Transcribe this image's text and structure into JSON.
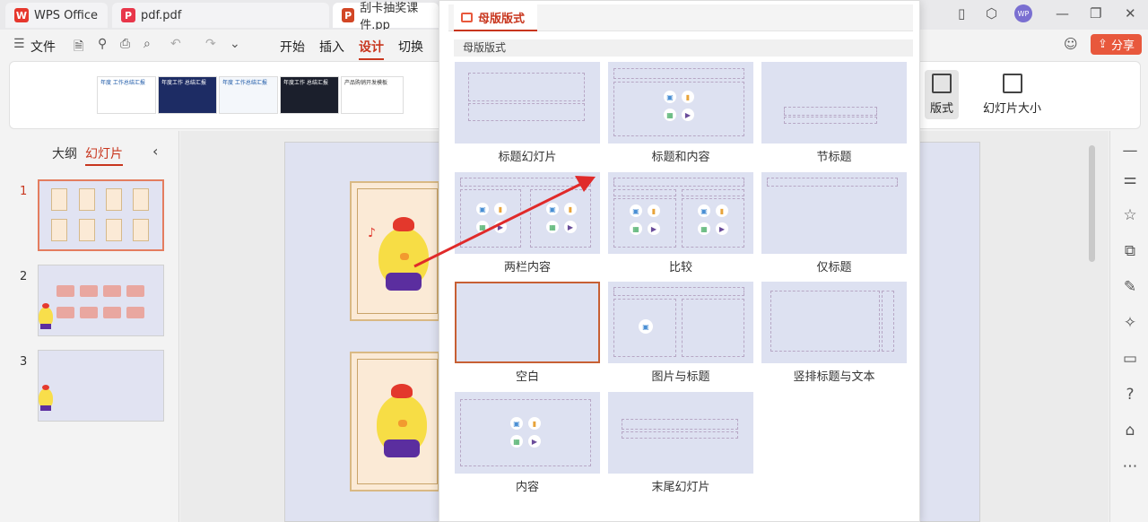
{
  "tabs": [
    {
      "label": "WPS Office",
      "icon": "wps-logo-icon",
      "color": "#e6372d"
    },
    {
      "label": "pdf.pdf",
      "icon": "pdf-file-icon",
      "color": "#e8364a"
    },
    {
      "label": "刮卡抽奖课件.pp",
      "icon": "ppt-file-icon",
      "color": "#d24625"
    }
  ],
  "user_avatar": "WP",
  "menu": {
    "file": "文件",
    "items": [
      "开始",
      "插入",
      "设计",
      "切换"
    ],
    "active": "设计"
  },
  "share_label": "分享",
  "ribbon": {
    "templates": [
      {
        "text": "年度 工作总结汇报",
        "bg": "#ffffff"
      },
      {
        "text": "年度工作 总结汇报",
        "bg": "#1d2c64"
      },
      {
        "text": "年度 工作总结汇报",
        "bg": "#f4f7fb"
      },
      {
        "text": "年度工作 总结汇报",
        "bg": "#1b1f2c"
      },
      {
        "text": "产品购销开发模板",
        "bg": "#ffffff"
      }
    ],
    "layout_button": "版式",
    "slide_size_button": "幻灯片大小"
  },
  "left_panel": {
    "outline_tab": "大纲",
    "slides_tab": "幻灯片",
    "slides": [
      {
        "num": "1"
      },
      {
        "num": "2"
      },
      {
        "num": "3"
      }
    ]
  },
  "dropdown": {
    "tab_label": "母版版式",
    "section_label": "母版版式",
    "layouts": [
      {
        "label": "标题幻灯片"
      },
      {
        "label": "标题和内容"
      },
      {
        "label": "节标题"
      },
      {
        "label": "两栏内容"
      },
      {
        "label": "比较"
      },
      {
        "label": "仅标题"
      },
      {
        "label": "空白"
      },
      {
        "label": "图片与标题"
      },
      {
        "label": "竖排标题与文本"
      },
      {
        "label": "内容"
      },
      {
        "label": "末尾幻灯片"
      }
    ],
    "selected": "空白"
  },
  "colors": {
    "accent": "#c8361e",
    "share_bg": "#e8583c",
    "layout_bg": "#dde1f1",
    "arrow": "#e02a2a"
  }
}
